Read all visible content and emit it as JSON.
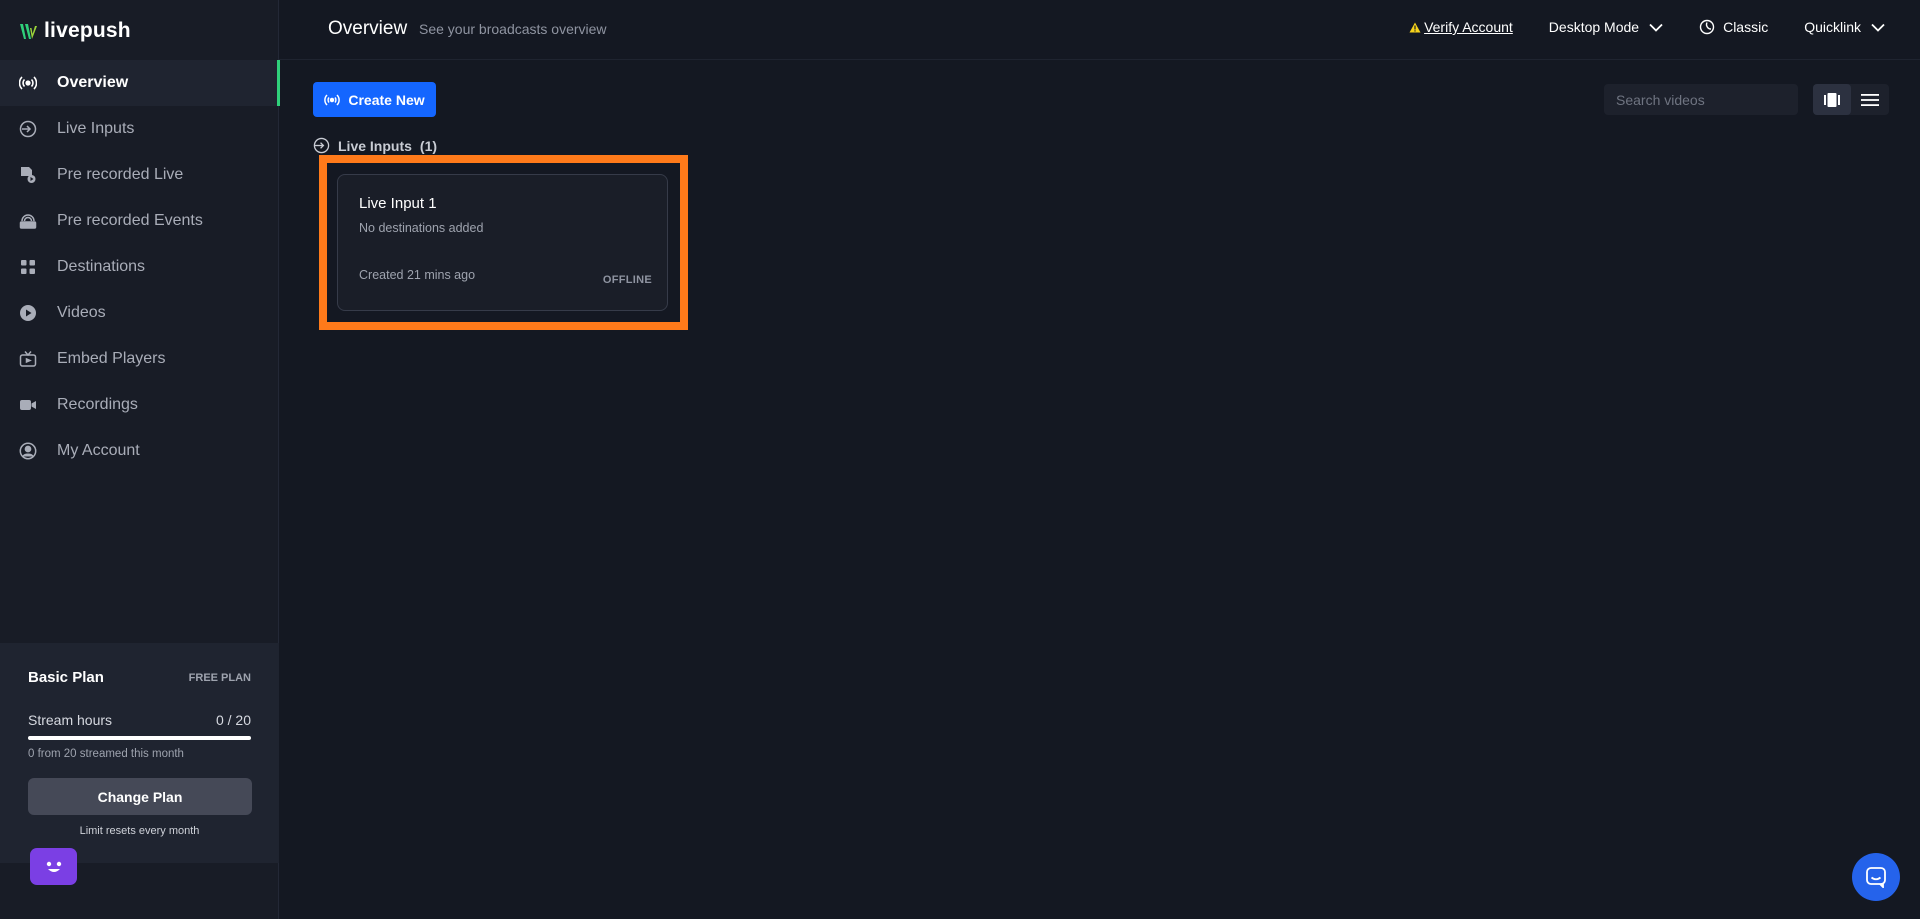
{
  "brand": {
    "name": "livepush",
    "accent": "#2fd07a"
  },
  "header": {
    "title": "Overview",
    "subtitle": "See your broadcasts overview",
    "verify_label": "Verify Account",
    "mode_label": "Desktop Mode",
    "classic_label": "Classic",
    "quicklink_label": "Quicklink"
  },
  "sidebar": {
    "items": [
      {
        "label": "Overview",
        "icon": "broadcast-icon",
        "active": true
      },
      {
        "label": "Live Inputs",
        "icon": "login-arrow-icon"
      },
      {
        "label": "Pre recorded Live",
        "icon": "video-file-icon"
      },
      {
        "label": "Pre recorded Events",
        "icon": "live-event-icon"
      },
      {
        "label": "Destinations",
        "icon": "grid-icon"
      },
      {
        "label": "Videos",
        "icon": "play-circle-icon"
      },
      {
        "label": "Embed Players",
        "icon": "tv-icon"
      },
      {
        "label": "Recordings",
        "icon": "camera-icon"
      },
      {
        "label": "My Account",
        "icon": "user-circle-icon"
      }
    ]
  },
  "plan": {
    "name": "Basic Plan",
    "tier": "FREE PLAN",
    "metric_label": "Stream hours",
    "metric_value": "0 / 20",
    "progress": 0,
    "note": "0 from 20 streamed this month",
    "button_label": "Change Plan",
    "reset_note": "Limit resets every month"
  },
  "main": {
    "create_label": "Create New",
    "search_placeholder": "Search videos",
    "section_label": "Live Inputs",
    "section_count": "(1)",
    "cards": [
      {
        "title": "Live Input 1",
        "subtitle": "No destinations added",
        "created": "Created 21 mins ago",
        "status": "OFFLINE"
      }
    ]
  },
  "colors": {
    "primary": "#1466ff",
    "highlight": "#ff7a1a",
    "bot": "#7b3fe4",
    "chat": "#2563eb"
  }
}
